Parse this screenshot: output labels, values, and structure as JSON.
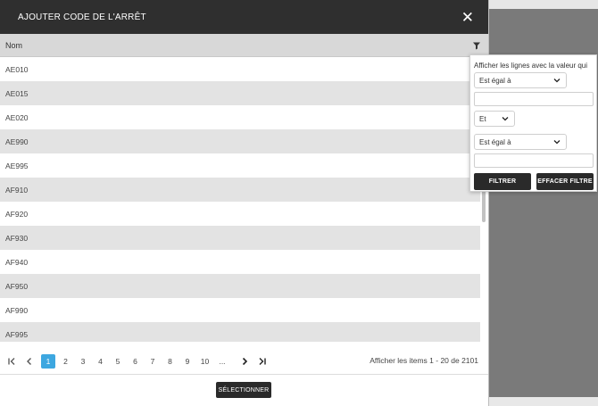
{
  "dialog": {
    "title": "AJOUTER CODE DE L'ARRÊT",
    "close_glyph": "✕"
  },
  "grid": {
    "column_header": "Nom",
    "rows": [
      "AE010",
      "AE015",
      "AE020",
      "AE990",
      "AE995",
      "AF910",
      "AF920",
      "AF930",
      "AF940",
      "AF950",
      "AF990",
      "AF995"
    ]
  },
  "pager": {
    "pages": [
      "1",
      "2",
      "3",
      "4",
      "5",
      "6",
      "7",
      "8",
      "9",
      "10",
      "..."
    ],
    "active_page": "1",
    "info": "Afficher les items 1 - 20 de 2101"
  },
  "footer": {
    "select_label": "SÉLECTIONNER"
  },
  "filter": {
    "heading": "Afficher les lignes avec la valeur qui",
    "operator1": "Est égal à",
    "value1": "",
    "logic": "Et",
    "operator2": "Est égal à",
    "value2": "",
    "filter_button": "FILTRER",
    "clear_button": "EFFACER FILTRE"
  },
  "colors": {
    "header_bg": "#2f2f2f",
    "accent": "#3da7e0",
    "row_alt": "#e3e3e3",
    "button_bg": "#2a2a2a"
  },
  "icons": [
    "close-icon",
    "filter-icon",
    "first-page-icon",
    "prev-page-icon",
    "next-page-icon",
    "last-page-icon",
    "chevron-down-icon"
  ]
}
